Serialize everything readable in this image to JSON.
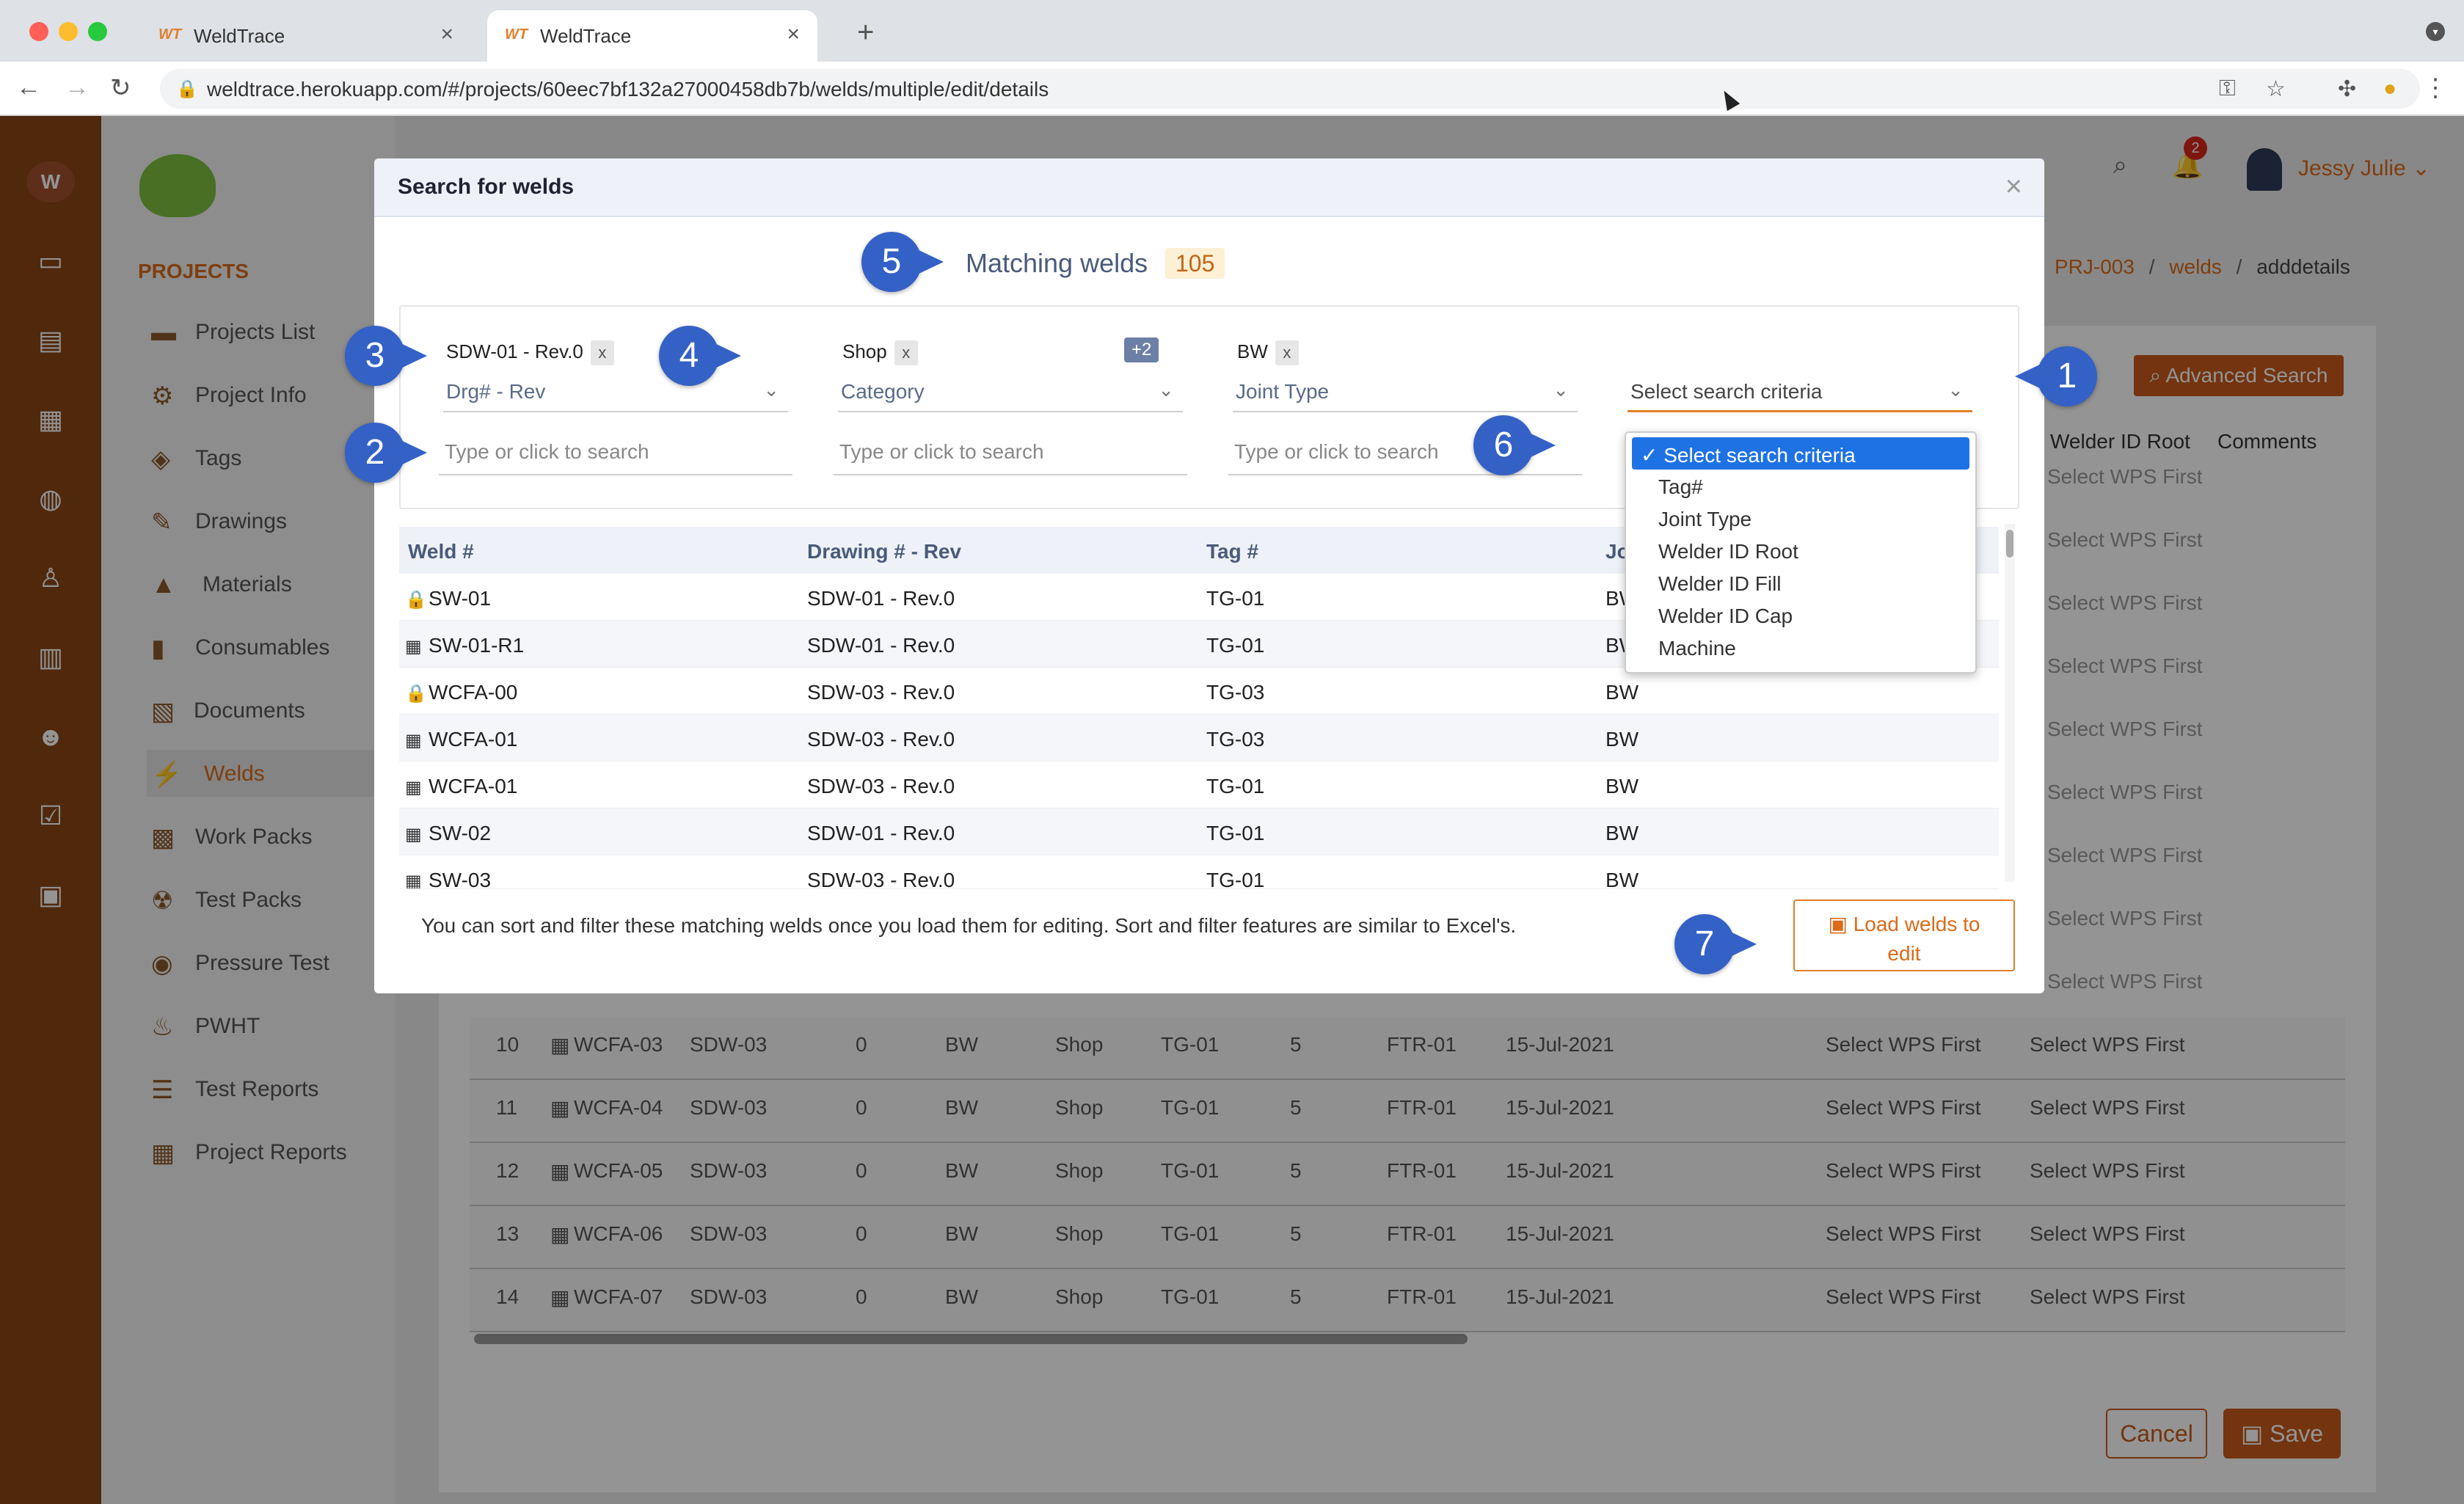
{
  "browser": {
    "tabs": [
      {
        "title": "WeldTrace",
        "favicon": "WT"
      },
      {
        "title": "WeldTrace",
        "favicon": "WT"
      }
    ],
    "new_tab": "+",
    "url": "weldtrace.herokuapp.com/#/projects/60eec7bf132a27000458db7b/welds/multiple/edit/details"
  },
  "sidebar": {
    "heading": "PROJECTS",
    "items": [
      {
        "label": "Projects List",
        "icon": "folder-icon"
      },
      {
        "label": "Project Info",
        "icon": "gear-icon"
      },
      {
        "label": "Tags",
        "icon": "tag-icon"
      },
      {
        "label": "Drawings",
        "icon": "drawing-icon"
      },
      {
        "label": "Materials",
        "icon": "materials-icon"
      },
      {
        "label": "Consumables",
        "icon": "consumables-icon"
      },
      {
        "label": "Documents",
        "icon": "documents-icon"
      },
      {
        "label": "Welds",
        "icon": "weld-icon"
      },
      {
        "label": "Work Packs",
        "icon": "workpack-icon"
      },
      {
        "label": "Test Packs",
        "icon": "testpack-icon"
      },
      {
        "label": "Pressure Test",
        "icon": "pressure-icon"
      },
      {
        "label": "PWHT",
        "icon": "pwht-icon"
      },
      {
        "label": "Test Reports",
        "icon": "report-icon"
      },
      {
        "label": "Project Reports",
        "icon": "project-report-icon"
      }
    ],
    "active": "Welds"
  },
  "header": {
    "notification_count": "2",
    "user_name": "Jessy Julie ⌄",
    "breadcrumb": [
      "PRJ-003",
      "/",
      "welds",
      "/",
      "adddetails"
    ]
  },
  "background_page": {
    "advanced_search_label": "Advanced Search",
    "col_welder_id_root": "Welder ID Root",
    "col_comments": "Comments",
    "select_wps_first": "Select WPS First",
    "rows": [
      {
        "n": "10",
        "weld": "WCFA-03",
        "drawing": "SDW-03",
        "rev": "0",
        "joint": "BW",
        "category": "Shop",
        "tag": "TG-01",
        "size": "5",
        "ftr": "FTR-01",
        "date": "15-Jul-2021"
      },
      {
        "n": "11",
        "weld": "WCFA-04",
        "drawing": "SDW-03",
        "rev": "0",
        "joint": "BW",
        "category": "Shop",
        "tag": "TG-01",
        "size": "5",
        "ftr": "FTR-01",
        "date": "15-Jul-2021"
      },
      {
        "n": "12",
        "weld": "WCFA-05",
        "drawing": "SDW-03",
        "rev": "0",
        "joint": "BW",
        "category": "Shop",
        "tag": "TG-01",
        "size": "5",
        "ftr": "FTR-01",
        "date": "15-Jul-2021"
      },
      {
        "n": "13",
        "weld": "WCFA-06",
        "drawing": "SDW-03",
        "rev": "0",
        "joint": "BW",
        "category": "Shop",
        "tag": "TG-01",
        "size": "5",
        "ftr": "FTR-01",
        "date": "15-Jul-2021"
      },
      {
        "n": "14",
        "weld": "WCFA-07",
        "drawing": "SDW-03",
        "rev": "0",
        "joint": "BW",
        "category": "Shop",
        "tag": "TG-01",
        "size": "5",
        "ftr": "FTR-01",
        "date": "15-Jul-2021"
      }
    ],
    "cancel_label": "Cancel",
    "save_label": "Save"
  },
  "modal": {
    "title": "Search for welds",
    "close": "×",
    "matching_label": "Matching welds",
    "matching_count": "105",
    "filters": [
      {
        "chip": "SDW-01 - Rev.0",
        "extra": "+2",
        "field": "Drg# - Rev",
        "placeholder": "Type or click to search"
      },
      {
        "chip": "Shop",
        "field": "Category",
        "placeholder": "Type or click to search"
      },
      {
        "chip": "BW",
        "field": "Joint Type",
        "placeholder": "Type or click to search"
      },
      {
        "field": "Select search criteria"
      }
    ],
    "chip_remove": "x",
    "dropdown_options": [
      "Select search criteria",
      "Tag#",
      "Joint Type",
      "Welder ID Root",
      "Welder ID Fill",
      "Welder ID Cap",
      "Machine"
    ],
    "dropdown_selected": "Select search criteria",
    "table": {
      "columns": [
        "Weld #",
        "Drawing # - Rev",
        "Tag #",
        "Jo"
      ],
      "rows": [
        {
          "weld": "SW-01",
          "icon": "lock-icon",
          "drawing": "SDW-01 - Rev.0",
          "tag": "TG-01",
          "joint": "BW"
        },
        {
          "weld": "SW-01-R1",
          "icon": "calendar-icon",
          "drawing": "SDW-01 - Rev.0",
          "tag": "TG-01",
          "joint": "BW"
        },
        {
          "weld": "WCFA-00",
          "icon": "lock-icon",
          "drawing": "SDW-03 - Rev.0",
          "tag": "TG-03",
          "joint": "BW"
        },
        {
          "weld": "WCFA-01",
          "icon": "calendar-icon",
          "drawing": "SDW-03 - Rev.0",
          "tag": "TG-03",
          "joint": "BW"
        },
        {
          "weld": "WCFA-01",
          "icon": "calendar-icon",
          "drawing": "SDW-03 - Rev.0",
          "tag": "TG-01",
          "joint": "BW"
        },
        {
          "weld": "SW-02",
          "icon": "calendar-icon",
          "drawing": "SDW-01 - Rev.0",
          "tag": "TG-01",
          "joint": "BW"
        },
        {
          "weld": "SW-03",
          "icon": "calendar-icon",
          "drawing": "SDW-03 - Rev.0",
          "tag": "TG-01",
          "joint": "BW"
        }
      ]
    },
    "hint": "You can sort and filter these matching welds once you load them for editing. Sort and filter features are similar to Excel's.",
    "load_button_line1": "Load welds to",
    "load_button_line2": "edit"
  },
  "callouts": [
    "1",
    "2",
    "3",
    "4",
    "5",
    "6",
    "7"
  ],
  "colors": {
    "brand_orange": "#d96b1a",
    "rail_brown": "#8b4513",
    "callout_blue": "#3461c5",
    "selected_blue": "#1f72e4"
  }
}
